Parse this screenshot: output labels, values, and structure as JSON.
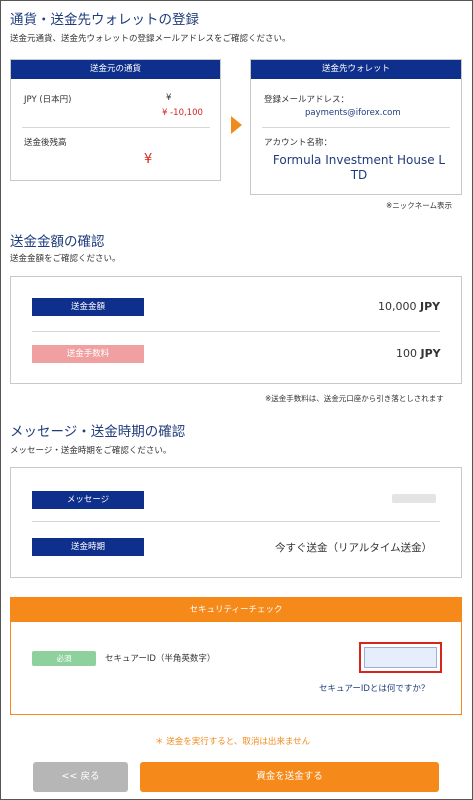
{
  "page": {
    "title": "通貨・送金先ウォレットの登録",
    "subtitle": "送金元通貨、送金先ウォレットの登録メールアドレスをご確認ください。"
  },
  "source_card": {
    "header": "送金元の通貨",
    "currency_label": "JPY (日本円)",
    "currency_symbol": "¥",
    "amount": "¥ -10,100",
    "balance_label": "送金後残高",
    "balance_value": "¥"
  },
  "dest_card": {
    "header": "送金先ウォレット",
    "email_label": "登録メールアドレス：",
    "email_value": "payments@iforex.com",
    "account_label": "アカウント名称：",
    "account_value_line1": "Formula Investment House L",
    "account_value_line2": "TD",
    "note": "※ニックネーム表示"
  },
  "amount_section": {
    "title": "送金金額の確認",
    "subtitle": "送金金額をご確認ください。",
    "amount_label": "送金金額",
    "amount_value": "10,000",
    "amount_unit": "JPY",
    "fee_label": "送金手数料",
    "fee_value": "100",
    "fee_unit": "JPY",
    "note": "※送金手数料は、送金元口座から引き落としされます"
  },
  "message_section": {
    "title": "メッセージ・送金時期の確認",
    "subtitle": "メッセージ・送金時期をご確認ください。",
    "message_label": "メッセージ",
    "message_value": "",
    "timing_label": "送金時期",
    "timing_value": "今すぐ送金（リアルタイム送金）"
  },
  "security": {
    "header": "セキュリティーチェック",
    "required_badge": "必須",
    "field_label": "セキュアーID（半角英数字）",
    "input_value": "",
    "help_link": "セキュアーIDとは何ですか？"
  },
  "warning": "＊ 送金を実行すると、取消は出来ません",
  "buttons": {
    "back": "<< 戻る",
    "send": "資金を送金する"
  },
  "colors": {
    "navy": "#0f2f8c",
    "orange": "#f58a1a",
    "red": "#d9241c",
    "green_badge": "#8fd19e",
    "pink": "#f0a0a0"
  }
}
